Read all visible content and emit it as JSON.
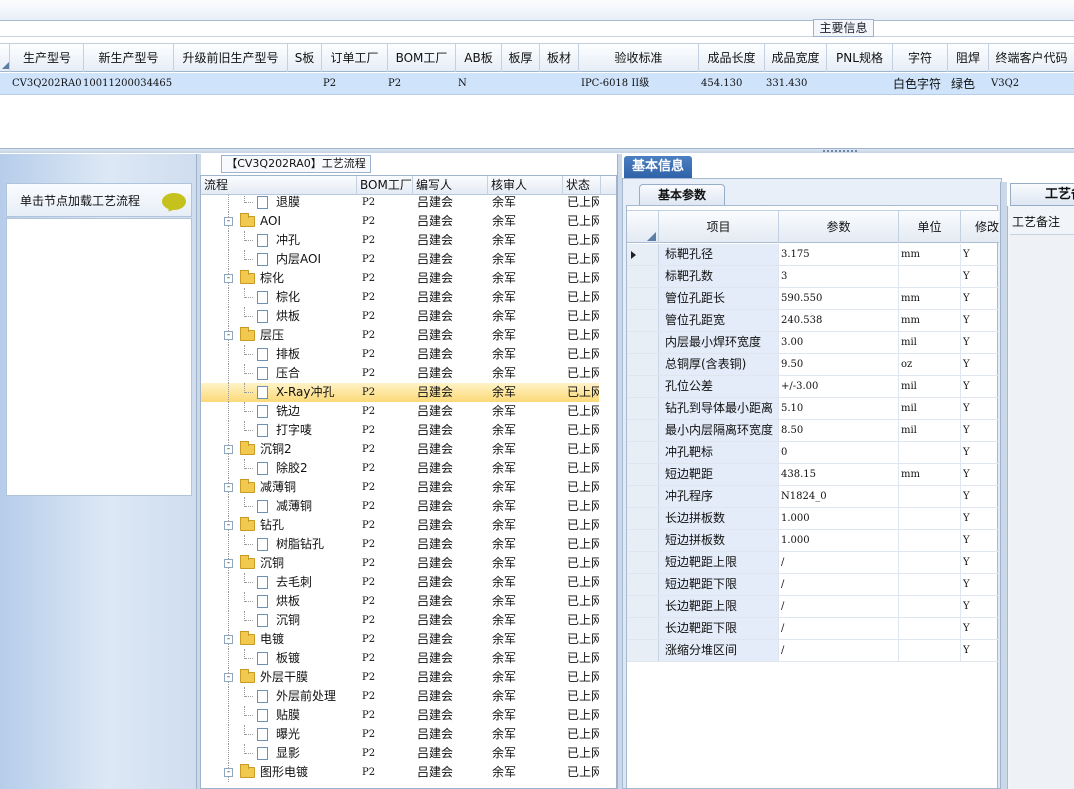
{
  "main_info": {
    "title": "主要信息",
    "columns": [
      "生产型号",
      "新生产型号",
      "升级前旧生产型号",
      "S板",
      "订单工厂",
      "BOM工厂",
      "AB板",
      "板厚",
      "板材",
      "验收标准",
      "成品长度",
      "成品宽度",
      "PNL规格",
      "字符",
      "阻焊",
      "终端客户代码"
    ],
    "row": {
      "prod_model": "CV3Q202RA0",
      "new_model": "10011200034465",
      "old_model": "",
      "s_board": "",
      "order_factory": "P2",
      "bom_factory": "P2",
      "ab_board": "N",
      "thickness": "",
      "material": "",
      "standard": "IPC-6018 II级",
      "length": "454.130",
      "width": "331.430",
      "pnl": "",
      "char": "白色字符",
      "mask": "绿色",
      "customer": "V3Q2"
    }
  },
  "left_panel": {
    "node_tip": "单击节点加载工艺流程",
    "bubble_icon": "speech-bubble-icon",
    "bubble_color": "#c6c21d"
  },
  "flow": {
    "title": "【CV3Q202RA0】工艺流程",
    "headers": [
      "流程",
      "BOM工厂",
      "编写人",
      "核审人",
      "状态"
    ],
    "rows": [
      {
        "name": "退膜",
        "level": 2,
        "bom": "P2",
        "writer": "吕建会",
        "reviewer": "余军",
        "status": "已上网"
      },
      {
        "name": "AOI",
        "level": 1,
        "bom": "P2",
        "writer": "吕建会",
        "reviewer": "余军",
        "status": "已上网"
      },
      {
        "name": "冲孔",
        "level": 2,
        "bom": "P2",
        "writer": "吕建会",
        "reviewer": "余军",
        "status": "已上网"
      },
      {
        "name": "内层AOI",
        "level": 2,
        "bom": "P2",
        "writer": "吕建会",
        "reviewer": "余军",
        "status": "已上网"
      },
      {
        "name": "棕化",
        "level": 1,
        "bom": "P2",
        "writer": "吕建会",
        "reviewer": "余军",
        "status": "已上网"
      },
      {
        "name": "棕化",
        "level": 2,
        "bom": "P2",
        "writer": "吕建会",
        "reviewer": "余军",
        "status": "已上网"
      },
      {
        "name": "烘板",
        "level": 2,
        "bom": "P2",
        "writer": "吕建会",
        "reviewer": "余军",
        "status": "已上网"
      },
      {
        "name": "层压",
        "level": 1,
        "bom": "P2",
        "writer": "吕建会",
        "reviewer": "余军",
        "status": "已上网"
      },
      {
        "name": "排板",
        "level": 2,
        "bom": "P2",
        "writer": "吕建会",
        "reviewer": "余军",
        "status": "已上网"
      },
      {
        "name": "压合",
        "level": 2,
        "bom": "P2",
        "writer": "吕建会",
        "reviewer": "余军",
        "status": "已上网"
      },
      {
        "name": "X-Ray冲孔",
        "level": 2,
        "bom": "P2",
        "writer": "吕建会",
        "reviewer": "余军",
        "status": "已上网",
        "selected": true
      },
      {
        "name": "铣边",
        "level": 2,
        "bom": "P2",
        "writer": "吕建会",
        "reviewer": "余军",
        "status": "已上网"
      },
      {
        "name": "打字唛",
        "level": 2,
        "bom": "P2",
        "writer": "吕建会",
        "reviewer": "余军",
        "status": "已上网"
      },
      {
        "name": "沉铜2",
        "level": 1,
        "bom": "P2",
        "writer": "吕建会",
        "reviewer": "余军",
        "status": "已上网"
      },
      {
        "name": "除胶2",
        "level": 2,
        "bom": "P2",
        "writer": "吕建会",
        "reviewer": "余军",
        "status": "已上网"
      },
      {
        "name": "减薄铜",
        "level": 1,
        "bom": "P2",
        "writer": "吕建会",
        "reviewer": "余军",
        "status": "已上网"
      },
      {
        "name": "减薄铜",
        "level": 2,
        "bom": "P2",
        "writer": "吕建会",
        "reviewer": "余军",
        "status": "已上网"
      },
      {
        "name": "钻孔",
        "level": 1,
        "bom": "P2",
        "writer": "吕建会",
        "reviewer": "余军",
        "status": "已上网"
      },
      {
        "name": "树脂钻孔",
        "level": 2,
        "bom": "P2",
        "writer": "吕建会",
        "reviewer": "余军",
        "status": "已上网"
      },
      {
        "name": "沉铜",
        "level": 1,
        "bom": "P2",
        "writer": "吕建会",
        "reviewer": "余军",
        "status": "已上网"
      },
      {
        "name": "去毛刺",
        "level": 2,
        "bom": "P2",
        "writer": "吕建会",
        "reviewer": "余军",
        "status": "已上网"
      },
      {
        "name": "烘板",
        "level": 2,
        "bom": "P2",
        "writer": "吕建会",
        "reviewer": "余军",
        "status": "已上网"
      },
      {
        "name": "沉铜",
        "level": 2,
        "bom": "P2",
        "writer": "吕建会",
        "reviewer": "余军",
        "status": "已上网"
      },
      {
        "name": "电镀",
        "level": 1,
        "bom": "P2",
        "writer": "吕建会",
        "reviewer": "余军",
        "status": "已上网"
      },
      {
        "name": "板镀",
        "level": 2,
        "bom": "P2",
        "writer": "吕建会",
        "reviewer": "余军",
        "status": "已上网"
      },
      {
        "name": "外层干膜",
        "level": 1,
        "bom": "P2",
        "writer": "吕建会",
        "reviewer": "余军",
        "status": "已上网"
      },
      {
        "name": "外层前处理",
        "level": 2,
        "bom": "P2",
        "writer": "吕建会",
        "reviewer": "余军",
        "status": "已上网"
      },
      {
        "name": "贴膜",
        "level": 2,
        "bom": "P2",
        "writer": "吕建会",
        "reviewer": "余军",
        "status": "已上网"
      },
      {
        "name": "曝光",
        "level": 2,
        "bom": "P2",
        "writer": "吕建会",
        "reviewer": "余军",
        "status": "已上网"
      },
      {
        "name": "显影",
        "level": 2,
        "bom": "P2",
        "writer": "吕建会",
        "reviewer": "余军",
        "status": "已上网"
      },
      {
        "name": "图形电镀",
        "level": 1,
        "bom": "P2",
        "writer": "吕建会",
        "reviewer": "余军",
        "status": "已上网"
      }
    ]
  },
  "basic": {
    "tab": "基本信息",
    "subtab": "基本参数",
    "headers": [
      "项目",
      "参数",
      "单位",
      "修改"
    ],
    "rows": [
      {
        "item": "标靶孔径",
        "value": "3.175",
        "unit": "mm",
        "mod": "Y",
        "current": true
      },
      {
        "item": "标靶孔数",
        "value": "3",
        "unit": "",
        "mod": "Y"
      },
      {
        "item": "管位孔距长",
        "value": "590.550",
        "unit": "mm",
        "mod": "Y"
      },
      {
        "item": "管位孔距宽",
        "value": "240.538",
        "unit": "mm",
        "mod": "Y"
      },
      {
        "item": "内层最小焊环宽度",
        "value": "3.00",
        "unit": "mil",
        "mod": "Y"
      },
      {
        "item": "总铜厚(含表铜)",
        "value": "9.50",
        "unit": "oz",
        "mod": "Y"
      },
      {
        "item": "孔位公差",
        "value": "+/-3.00",
        "unit": "mil",
        "mod": "Y"
      },
      {
        "item": "钻孔到导体最小距离",
        "value": "5.10",
        "unit": "mil",
        "mod": "Y"
      },
      {
        "item": "最小内层隔离环宽度",
        "value": "8.50",
        "unit": "mil",
        "mod": "Y"
      },
      {
        "item": "冲孔靶标",
        "value": "0",
        "unit": "",
        "mod": "Y"
      },
      {
        "item": "短边靶距",
        "value": "438.15",
        "unit": "mm",
        "mod": "Y"
      },
      {
        "item": "冲孔程序",
        "value": "N1824_0",
        "unit": "",
        "mod": "Y"
      },
      {
        "item": "长边拼板数",
        "value": "1.000",
        "unit": "",
        "mod": "Y"
      },
      {
        "item": "短边拼板数",
        "value": "1.000",
        "unit": "",
        "mod": "Y"
      },
      {
        "item": "短边靶距上限",
        "value": "/",
        "unit": "",
        "mod": "Y"
      },
      {
        "item": "短边靶距下限",
        "value": "/",
        "unit": "",
        "mod": "Y"
      },
      {
        "item": "长边靶距上限",
        "value": "/",
        "unit": "",
        "mod": "Y"
      },
      {
        "item": "长边靶距下限",
        "value": "/",
        "unit": "",
        "mod": "Y"
      },
      {
        "item": "涨缩分堆区间",
        "value": "/",
        "unit": "",
        "mod": "Y"
      }
    ]
  },
  "remarks": {
    "tab": "工艺备注",
    "label": "工艺备注"
  },
  "colors": {
    "selected_row": "#cfe3fb",
    "highlight_row": "#fbd977",
    "tab_blue": "#2f62a8"
  }
}
